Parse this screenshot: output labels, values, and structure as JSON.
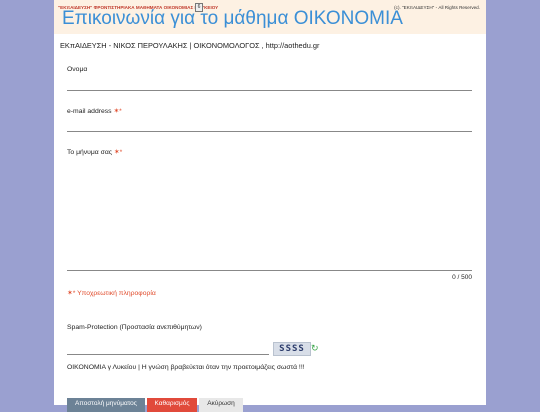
{
  "topbar": {
    "left_text": "\"ΕΚπΑΙΔΕΥΣΗ\" ΦΡΟΝΤΙΣΤΗΡΙΑΚΑ ΜΑΘΗΜΑΤΑ ΟΙΚΟΝΟΜΙΑΣ Γ ΛΥΚΕΙΟΥ",
    "small_button": "6",
    "right_text": "(c). \"ΕΚπΑΙΔΕΥΣΗ\" - All Rights Reserved."
  },
  "page": {
    "title": "Επικοινωνία για το μάθημα ΟΙΚΟΝΟΜΙΑ",
    "subtitle": "ΕΚπΑΙΔΕΥΣΗ - ΝΙΚΟΣ ΠΕΡΟΥΛΑΚΗΣ | ΟΙΚΟΝΟΜΟΛΟΓΟΣ , http://aothedu.gr"
  },
  "form": {
    "name_label": "Ονομα",
    "email_label": "e-mail address",
    "message_label": "Το μήνυμα σας",
    "required_marker": "✶*",
    "counter": "0 / 500",
    "required_note": "✶* Υποχρεωτική πληροφορία",
    "spam_label": "Spam-Protection (Προστασία ανεπιθύμητων)",
    "captcha_code": "SSSS",
    "footer_text": "ΟΙΚΟΝΟΜΙΑ γ Λυκείου | Η γνώση βραβεύεται όταν την προετοιμάζεις σωστά !!!"
  },
  "buttons": {
    "send": "Αποστολή μηνύματος",
    "clear": "Καθαρισμός",
    "cancel": "Ακύρωση"
  },
  "colors": {
    "background": "#9aa0d0",
    "title": "#3b8fd6",
    "required": "#e04a2a"
  }
}
